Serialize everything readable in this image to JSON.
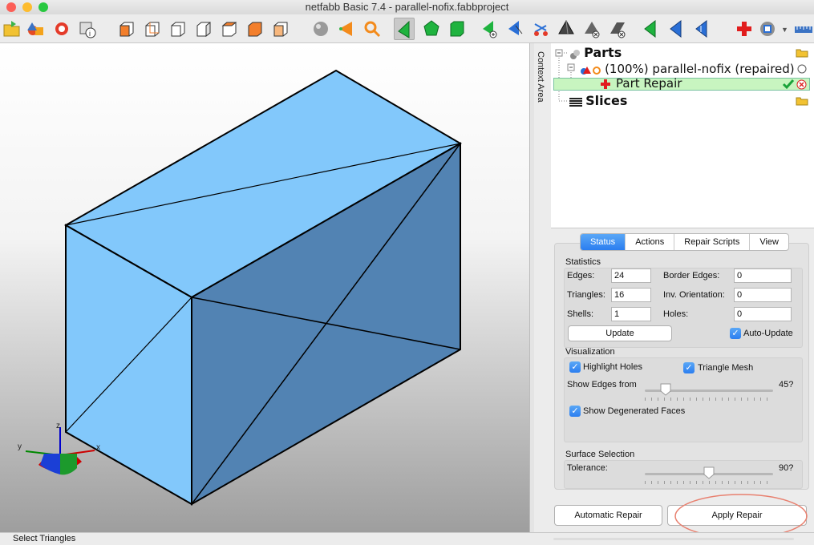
{
  "window": {
    "title": "netfabb Basic 7.4 - parallel-nofix.fabbproject",
    "traffic_lights": {
      "close": "#fc5f57",
      "minimize": "#fdbc2e",
      "zoom": "#28c840"
    }
  },
  "toolbar": {
    "icons": [
      "open-project-icon",
      "add-part-icon",
      "export-icon",
      "part-info-icon",
      "view-front-icon",
      "view-back-icon",
      "view-left-icon",
      "view-right-icon",
      "view-top-icon",
      "view-bottom-icon",
      "view-iso-icon",
      "sphere-render-icon",
      "cone-select-icon",
      "zoom-search-icon",
      "select-triangle-icon",
      "select-surface-icon",
      "select-shell-icon",
      "add-triangle-icon",
      "select-arrow-icon",
      "cut-icon",
      "tetrahedron-icon",
      "remove-triangle-icon",
      "remove-surface-icon",
      "triangle-green-icon",
      "triangle-blue-icon",
      "triangle-blue-icon-2",
      "triangle-green-icon-2",
      "repair-cross-icon",
      "measure-icon",
      "ruler-icon"
    ]
  },
  "context_area": {
    "label": "Context Area"
  },
  "tree": {
    "parts_label": "Parts",
    "part_name": "(100%) parallel-nofix (repaired)",
    "repair_label": "Part Repair",
    "slices_label": "Slices"
  },
  "panel": {
    "tabs": [
      "Status",
      "Actions",
      "Repair Scripts",
      "View"
    ],
    "active_tab": "Status",
    "statistics": {
      "title": "Statistics",
      "edges_label": "Edges:",
      "edges": "24",
      "border_edges_label": "Border Edges:",
      "border_edges": "0",
      "triangles_label": "Triangles:",
      "triangles": "16",
      "inv_orientation_label": "Inv. Orientation:",
      "inv_orientation": "0",
      "shells_label": "Shells:",
      "shells": "1",
      "holes_label": "Holes:",
      "holes": "0",
      "update_label": "Update",
      "auto_update_label": "Auto-Update"
    },
    "visualization": {
      "title": "Visualization",
      "highlight_holes_label": "Highlight Holes",
      "triangle_mesh_label": "Triangle Mesh",
      "show_edges_label": "Show Edges from",
      "show_edges_value": "45?",
      "show_edges_level": 0.16,
      "show_degenerated_label": "Show Degenerated Faces"
    },
    "surface_selection": {
      "title": "Surface Selection",
      "tolerance_label": "Tolerance:",
      "tolerance_value": "90?",
      "tolerance_level": 0.5
    },
    "buttons": {
      "automatic_repair": "Automatic Repair",
      "apply_repair": "Apply Repair"
    }
  },
  "axes": {
    "x": "x",
    "y": "y",
    "z": "z"
  },
  "statusbar": {
    "text": "Select Triangles"
  },
  "colors": {
    "mesh_light": "#82c8fb",
    "mesh_dark": "#5283b3",
    "repair_highlight": "#c8f5c0",
    "accent_blue": "#2b7ef0",
    "annotation_circle": "#e8806f"
  }
}
